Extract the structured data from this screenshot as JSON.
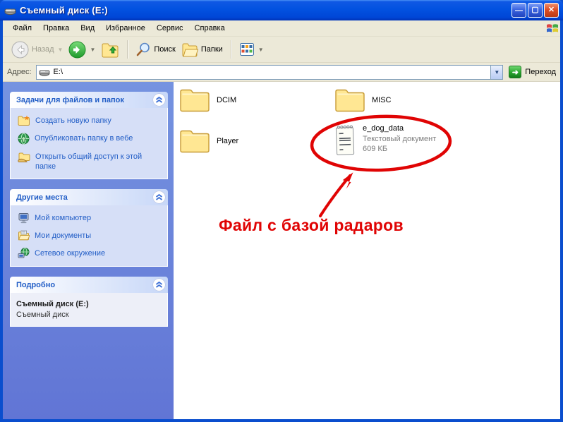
{
  "window": {
    "title": "Съемный диск (E:)"
  },
  "menu": {
    "items": [
      "Файл",
      "Правка",
      "Вид",
      "Избранное",
      "Сервис",
      "Справка"
    ]
  },
  "toolbar": {
    "back_label": "Назад",
    "search_label": "Поиск",
    "folders_label": "Папки"
  },
  "address": {
    "label": "Адрес:",
    "value": "E:\\",
    "go_label": "Переход"
  },
  "sidebar": {
    "panels": [
      {
        "title": "Задачи для файлов и папок",
        "items": [
          {
            "label": "Создать новую папку",
            "icon": "new-folder-icon"
          },
          {
            "label": "Опубликовать папку в вебе",
            "icon": "publish-web-icon"
          },
          {
            "label": "Открыть общий доступ к этой папке",
            "icon": "share-folder-icon"
          }
        ]
      },
      {
        "title": "Другие места",
        "items": [
          {
            "label": "Мой компьютер",
            "icon": "my-computer-icon"
          },
          {
            "label": "Мои документы",
            "icon": "my-documents-icon"
          },
          {
            "label": "Сетевое окружение",
            "icon": "network-icon"
          }
        ]
      },
      {
        "title": "Подробно",
        "details": {
          "title": "Съемный диск (E:)",
          "subtitle": "Съемный диск"
        }
      }
    ]
  },
  "files": {
    "folders": [
      {
        "name": "DCIM"
      },
      {
        "name": "MISC"
      },
      {
        "name": "Player"
      }
    ],
    "file": {
      "name": "e_dog_data",
      "type": "Текстовый документ",
      "size": "609 КБ"
    }
  },
  "annotation": {
    "text": "Файл с базой радаров",
    "color": "#e00404"
  }
}
